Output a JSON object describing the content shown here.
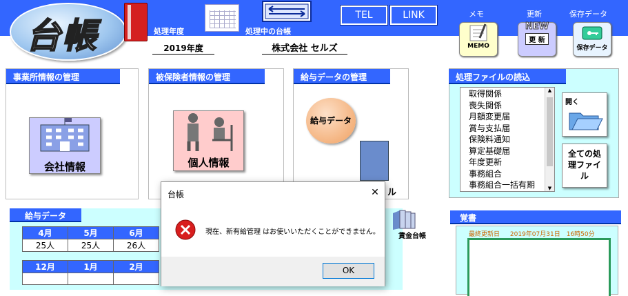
{
  "app_title": "台帳",
  "header": {
    "fiscal_year_label": "処理年度",
    "fiscal_year_value": "2019年度",
    "current_ledger_label": "処理中の台帳",
    "current_ledger_value": "株式会社 セルズ",
    "tel_label": "TEL",
    "link_label": "LINK",
    "memo_label": "メモ",
    "memo_icon_text": "MEMO",
    "update_label": "更新",
    "update_icon_text": "更 新",
    "update_badge": "NEW",
    "save_label": "保存データ",
    "save_icon_text": "保存データ"
  },
  "panels": {
    "office": {
      "title": "事業所情報の管理",
      "button": "会社情報"
    },
    "insured": {
      "title": "被保険者情報の管理",
      "button": "個人情報"
    },
    "salary": {
      "title": "給与データの管理",
      "button": "給与データ",
      "partial_label": "ル"
    }
  },
  "file_panel": {
    "title": "処理ファイルの読込",
    "files": [
      "取得関係",
      "喪失関係",
      "月額変更届",
      "賞与支払届",
      "保険料通知",
      "算定基礎届",
      "年度更新",
      "事務組合",
      "事務組合一括有期"
    ],
    "open_label": "開く",
    "all_files_label": "全ての処理ファイル"
  },
  "salary_data": {
    "title": "給与データ",
    "row1_months": [
      "4月",
      "5月",
      "6月"
    ],
    "row1_counts": [
      "25人",
      "25人",
      "26人"
    ],
    "row2_months": [
      "12月",
      "1月",
      "2月"
    ],
    "wage_ledger_label": "賃金台帳"
  },
  "memo_panel": {
    "title": "覚書",
    "last_updated_label": "最終更新日",
    "last_updated_value": "2019年07月31日　16時50分"
  },
  "dialog": {
    "title": "台帳",
    "message": "現在、新有給管理 はお使いいただくことができません。",
    "ok_label": "OK",
    "close_glyph": "✕"
  },
  "colors": {
    "header_blue": "#3366ff",
    "accent_cyan": "#ccffff",
    "error_red": "#d81e1e"
  }
}
